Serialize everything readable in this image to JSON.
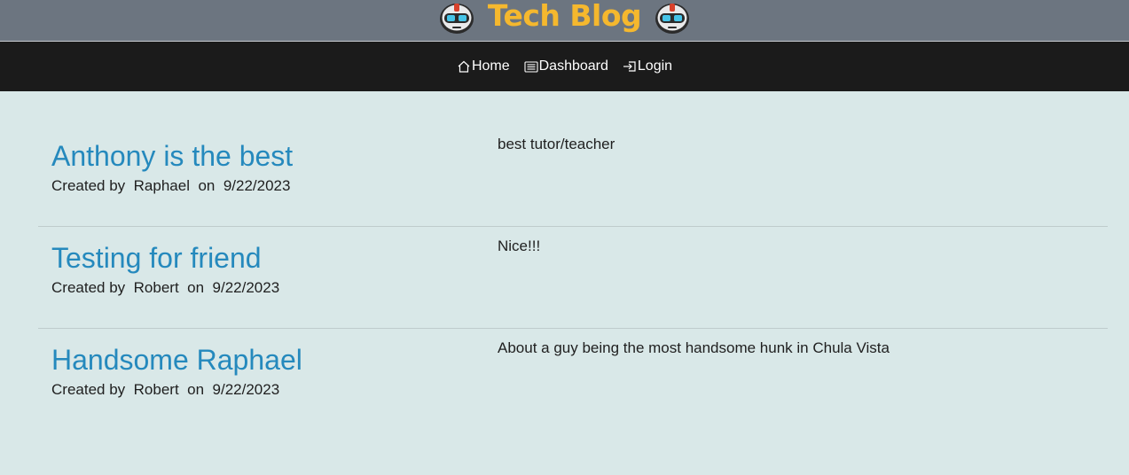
{
  "header": {
    "title": "Tech Blog",
    "logo_icon": "robot-icon",
    "accent_color": "#f5b82e"
  },
  "nav": {
    "items": [
      {
        "label": "Home",
        "icon": "home-icon"
      },
      {
        "label": "Dashboard",
        "icon": "list-icon"
      },
      {
        "label": "Login",
        "icon": "login-icon"
      }
    ]
  },
  "posts": [
    {
      "title": "Anthony is the best",
      "created_prefix": "Created by",
      "author": "Raphael",
      "on": "on",
      "date": "9/22/2023",
      "content": "best tutor/teacher"
    },
    {
      "title": "Testing for friend",
      "created_prefix": "Created by",
      "author": "Robert",
      "on": "on",
      "date": "9/22/2023",
      "content": "Nice!!!"
    },
    {
      "title": "Handsome Raphael",
      "created_prefix": "Created by",
      "author": "Robert",
      "on": "on",
      "date": "9/22/2023",
      "content": "About a guy being the most handsome hunk in Chula Vista"
    }
  ]
}
